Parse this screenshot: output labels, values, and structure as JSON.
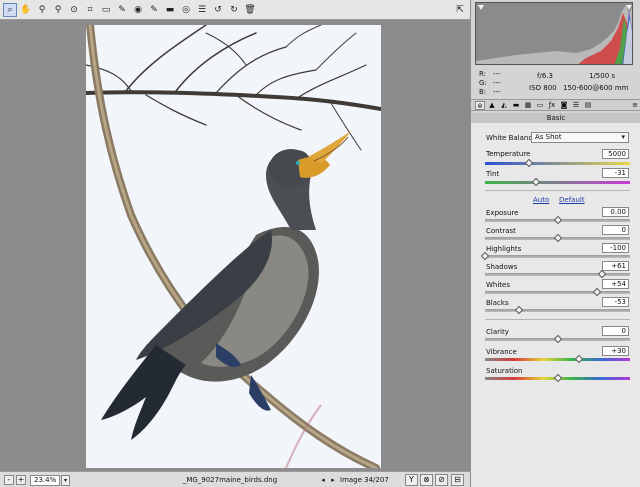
{
  "toolbar": {
    "tools": [
      "zoom-icon",
      "hand-icon",
      "white-balance-icon",
      "color-sampler-icon",
      "targeted-adjustment-icon",
      "crop-icon",
      "straighten-icon",
      "spot-removal-icon",
      "red-eye-icon",
      "adjustment-brush-icon",
      "graduated-filter-icon",
      "radial-filter-icon",
      "preferences-icon",
      "rotate-left-icon",
      "rotate-right-icon",
      "trash-icon"
    ],
    "glyphs": [
      "⌕",
      "✋",
      "⚲",
      "⚲",
      "⊙",
      "⌗",
      "▭",
      "✎",
      "◉",
      "✎",
      "▬",
      "◎",
      "☰",
      "↺",
      "↻",
      "🗑"
    ],
    "fullscreen_glyph": "⇱"
  },
  "status": {
    "zoom_minus": "-",
    "zoom_plus": "+",
    "zoom": "23.4%",
    "zoom_drop": "▾",
    "filename": "_MG_9027maine_birds.dng",
    "prev": "◂",
    "next": "▸",
    "image_count": "Image 34/207",
    "buttons": [
      "Y",
      "⊗",
      "⊘",
      "⊟"
    ]
  },
  "readout": {
    "r_label": "R:",
    "r_value": "---",
    "g_label": "G:",
    "g_value": "---",
    "b_label": "B:",
    "b_value": "---",
    "aperture": "f/6.3",
    "shutter": "1/500 s",
    "iso": "ISO 800",
    "lens": "150-600@600 mm"
  },
  "tabs": {
    "glyphs": [
      "⊛",
      "▲",
      "◭",
      "▬",
      "▦",
      "▭",
      "ƒx",
      "◙",
      "☰",
      "▤"
    ],
    "menu": "≡"
  },
  "basic": {
    "title": "Basic",
    "wb_label": "White Balance:",
    "wb_value": "As Shot",
    "wb_arrow": "▾",
    "auto": "Auto",
    "default": "Default",
    "sliders": {
      "temperature": {
        "label": "Temperature",
        "value": "5000",
        "fraction": 0.3
      },
      "tint": {
        "label": "Tint",
        "value": "-31",
        "fraction": 0.35
      },
      "exposure": {
        "label": "Exposure",
        "value": "0.00",
        "fraction": 0.5
      },
      "contrast": {
        "label": "Contrast",
        "value": "0",
        "fraction": 0.5
      },
      "highlights": {
        "label": "Highlights",
        "value": "-100",
        "fraction": 0.0
      },
      "shadows": {
        "label": "Shadows",
        "value": "+61",
        "fraction": 0.805
      },
      "whites": {
        "label": "Whites",
        "value": "+54",
        "fraction": 0.77
      },
      "blacks": {
        "label": "Blacks",
        "value": "-53",
        "fraction": 0.235
      },
      "clarity": {
        "label": "Clarity",
        "value": "0",
        "fraction": 0.5
      },
      "vibrance": {
        "label": "Vibrance",
        "value": "+30",
        "fraction": 0.65
      },
      "saturation": {
        "label": "Saturation",
        "value": "0",
        "fraction": 0.5
      }
    }
  }
}
